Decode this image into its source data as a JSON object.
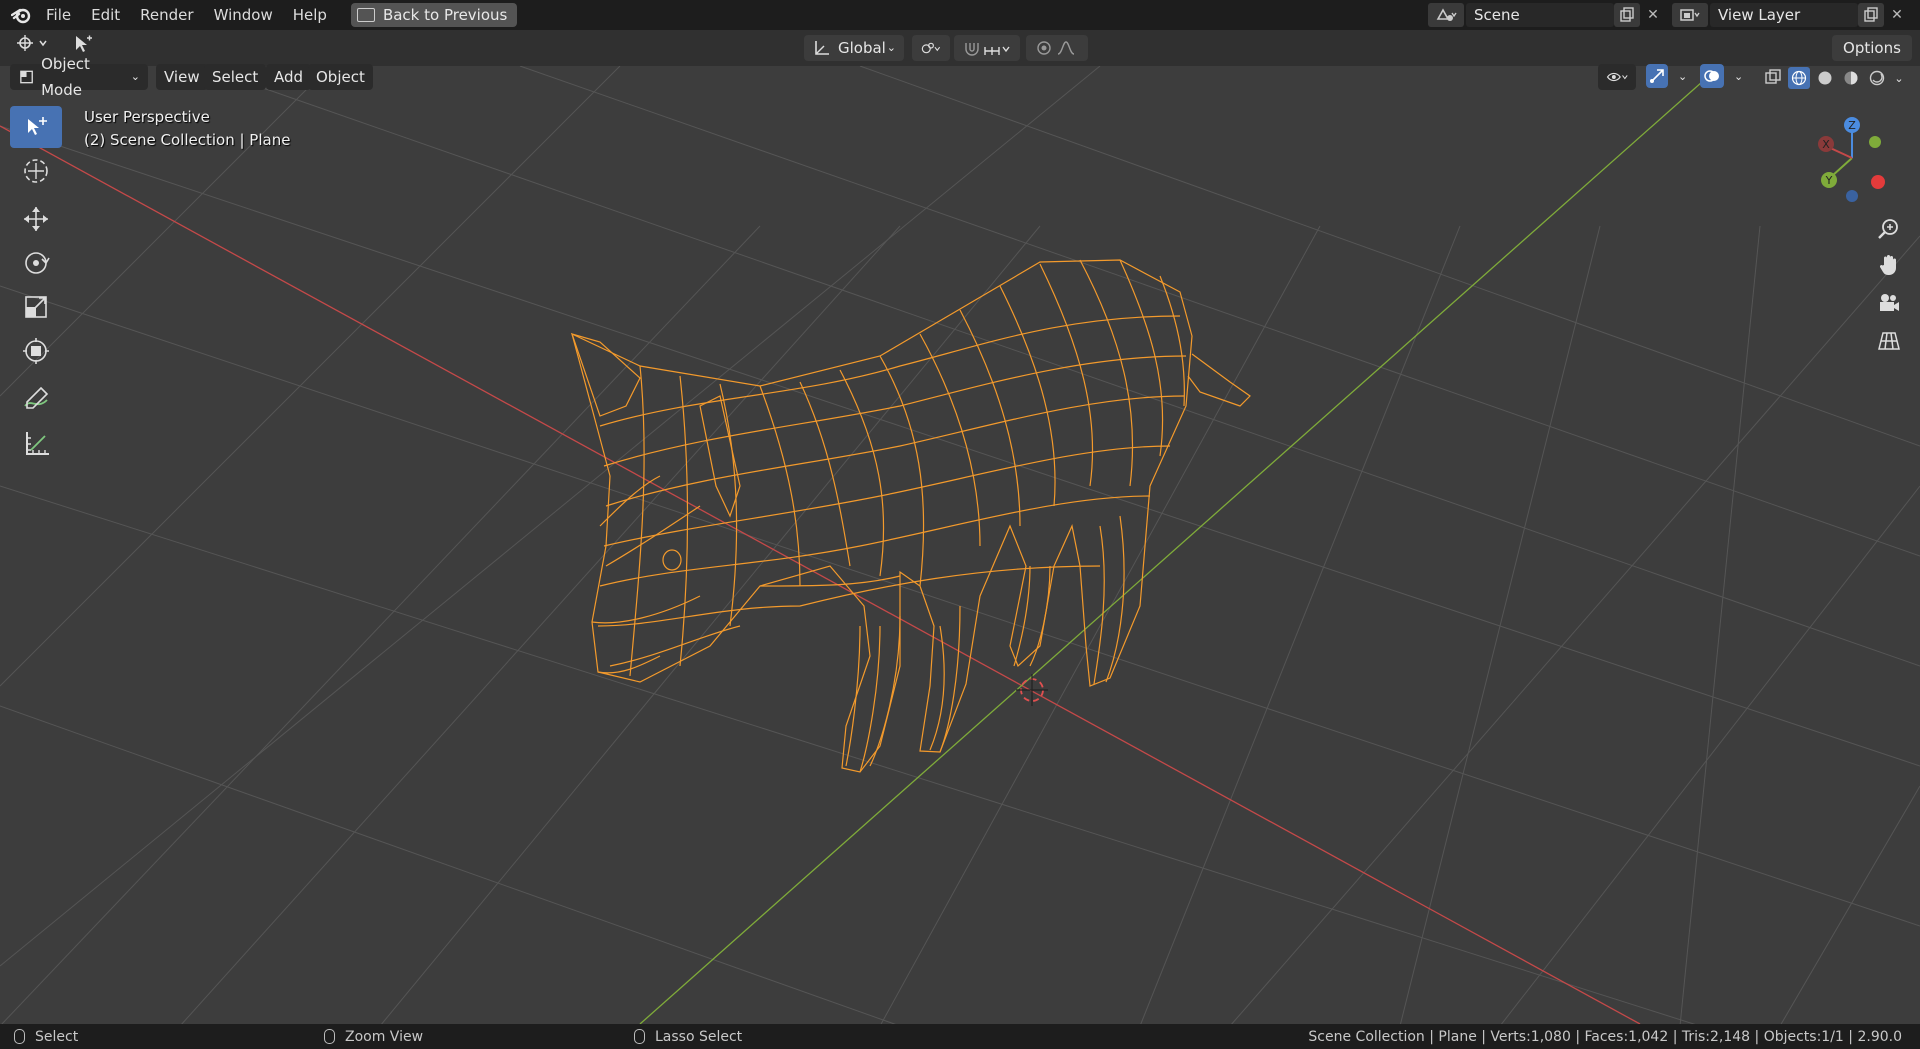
{
  "topbar": {
    "menus": [
      "File",
      "Edit",
      "Render",
      "Window",
      "Help"
    ],
    "back_label": "Back to Previous",
    "scene_name": "Scene",
    "view_layer": "View Layer"
  },
  "header": {
    "orientation": "Global",
    "options_label": "Options",
    "mode": "Object Mode",
    "view_menus": [
      "View",
      "Select",
      "Add",
      "Object"
    ]
  },
  "viewport": {
    "perspective": "User Perspective",
    "collection": "(2) Scene Collection | Plane",
    "gizmo": {
      "x": "X",
      "y": "Y",
      "z": "Z"
    }
  },
  "status": {
    "select": "Select",
    "zoom": "Zoom View",
    "lasso": "Lasso Select",
    "stats": "Scene Collection | Plane | Verts:1,080 | Faces:1,042 | Tris:2,148 | Objects:1/1 | 2.90.0"
  },
  "colors": {
    "accent": "#4772b3",
    "wire": "#f39a2c",
    "x_axis": "#c44949",
    "y_axis": "#7fab3a",
    "z_axis": "#4b8ce0"
  }
}
